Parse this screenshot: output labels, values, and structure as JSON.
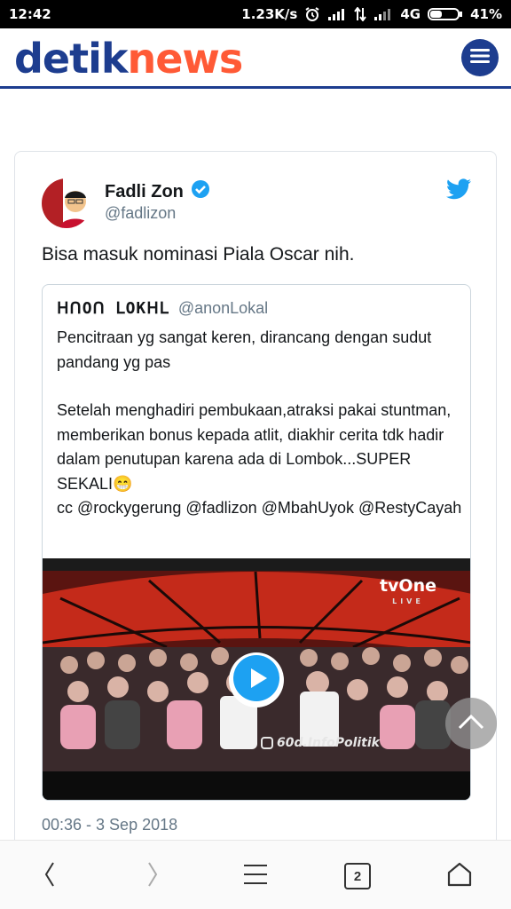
{
  "status_bar": {
    "time": "12:42",
    "speed": "1.23K/s",
    "network": "4G",
    "battery": "41%"
  },
  "header": {
    "logo_part1": "detik",
    "logo_part2": "news",
    "menu_icon": "hamburger-icon"
  },
  "tweet": {
    "author_name": "Fadli Zon",
    "author_handle": "@fadlizon",
    "verified_icon": "verified-badge-icon",
    "platform_icon": "twitter-bird-icon",
    "text": "Bisa masuk nominasi Piala Oscar nih.",
    "timestamp": "00:36 - 3 Sep 2018",
    "quoted": {
      "author_name": "ᕼᑎOᑎ ᒪOKᕼᒪ",
      "author_handle": "@anonLokal",
      "paragraph1": "Pencitraan yg sangat keren, dirancang dengan sudut pandang yg pas",
      "paragraph2": "Setelah menghadiri pembukaan,atraksi pakai stuntman, memberikan bonus kepada atlit, diakhir cerita tdk hadir dalam penutupan karena ada di Lombok...SUPER SEKALI😁",
      "paragraph3": "cc @rockygerung @fadlizon @MbahUyok @RestyCayah",
      "video": {
        "channel_logo": "tvOne",
        "channel_sub": "LIVE",
        "watermark": "60d.InfoPolitik",
        "play_icon": "play-icon"
      }
    }
  },
  "nav": {
    "tabs_count": "2",
    "icons": [
      "back-icon",
      "forward-icon",
      "menu-icon",
      "tabs-icon",
      "home-icon"
    ]
  },
  "colors": {
    "brand_blue": "#1d3d8f",
    "brand_orange": "#ff5a36",
    "twitter_blue": "#1da1f2"
  }
}
